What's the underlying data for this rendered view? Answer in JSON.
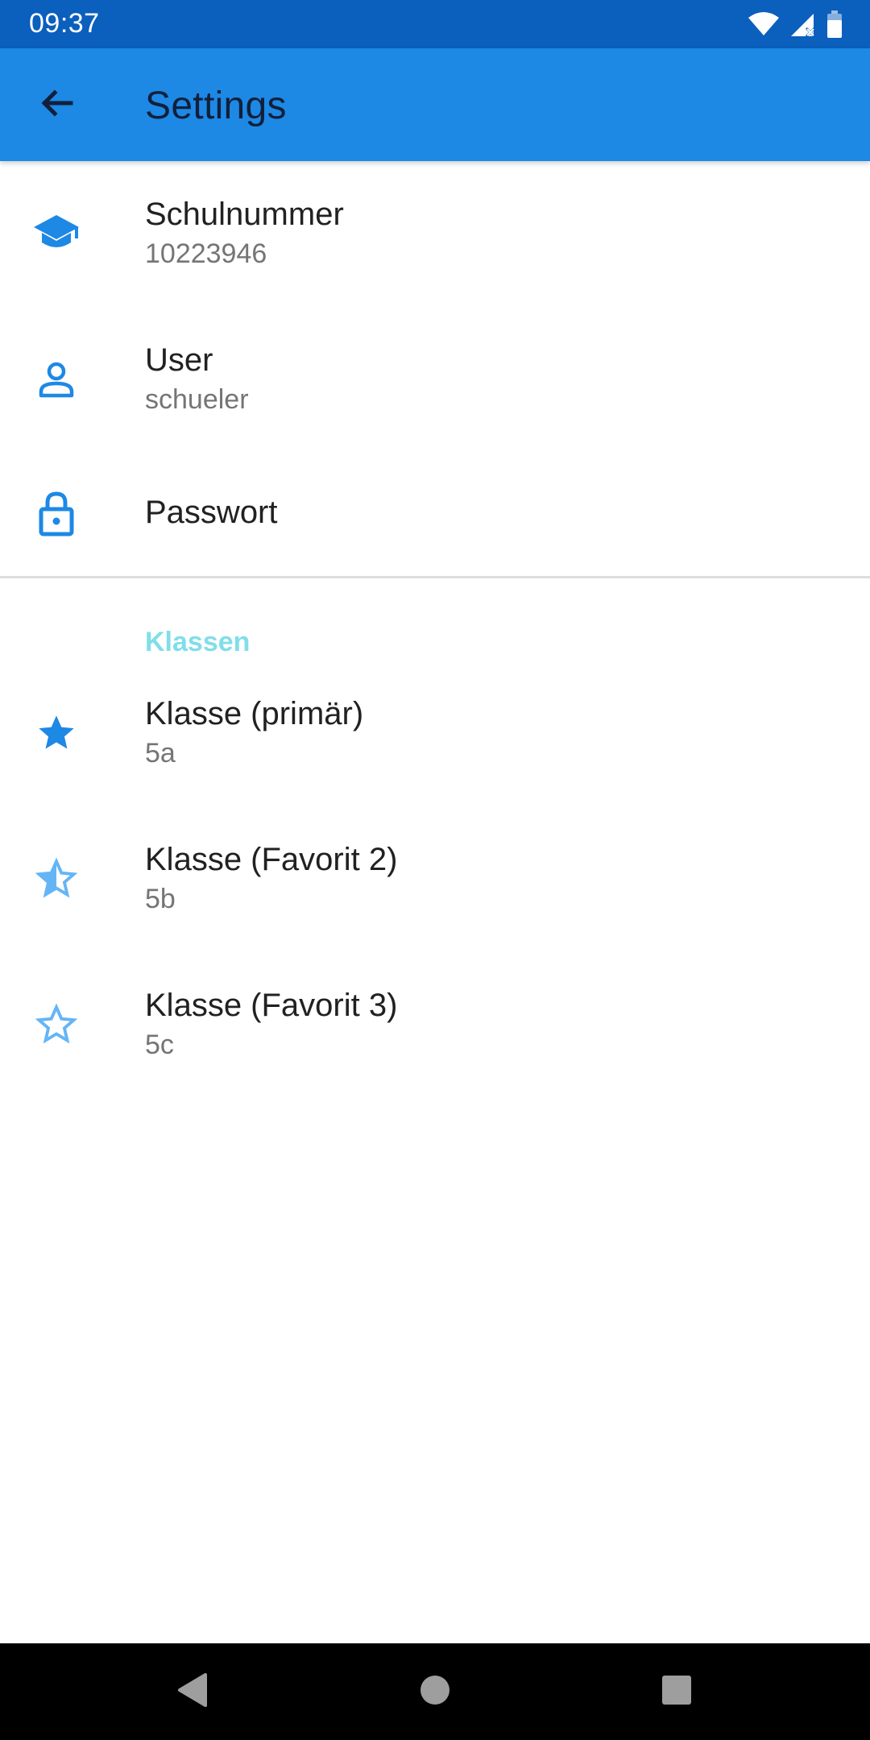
{
  "status_bar": {
    "time": "09:37"
  },
  "app_bar": {
    "title": "Settings"
  },
  "preferences": {
    "school_number": {
      "title": "Schulnummer",
      "value": "10223946",
      "icon": "school-icon"
    },
    "user": {
      "title": "User",
      "value": "schueler",
      "icon": "person-icon"
    },
    "password": {
      "title": "Passwort",
      "icon": "lock-icon"
    }
  },
  "classes": {
    "header": "Klassen",
    "items": [
      {
        "title": "Klasse (primär)",
        "value": "5a",
        "icon": "star-filled-icon"
      },
      {
        "title": "Klasse (Favorit 2)",
        "value": "5b",
        "icon": "star-half-icon"
      },
      {
        "title": "Klasse (Favorit 3)",
        "value": "5c",
        "icon": "star-outline-icon"
      }
    ]
  },
  "colors": {
    "status_bar": "#0b5fbd",
    "app_bar": "#1e88e5",
    "icon_primary": "#1e88e5",
    "icon_light": "#64b5f6",
    "category": "#80deea"
  }
}
